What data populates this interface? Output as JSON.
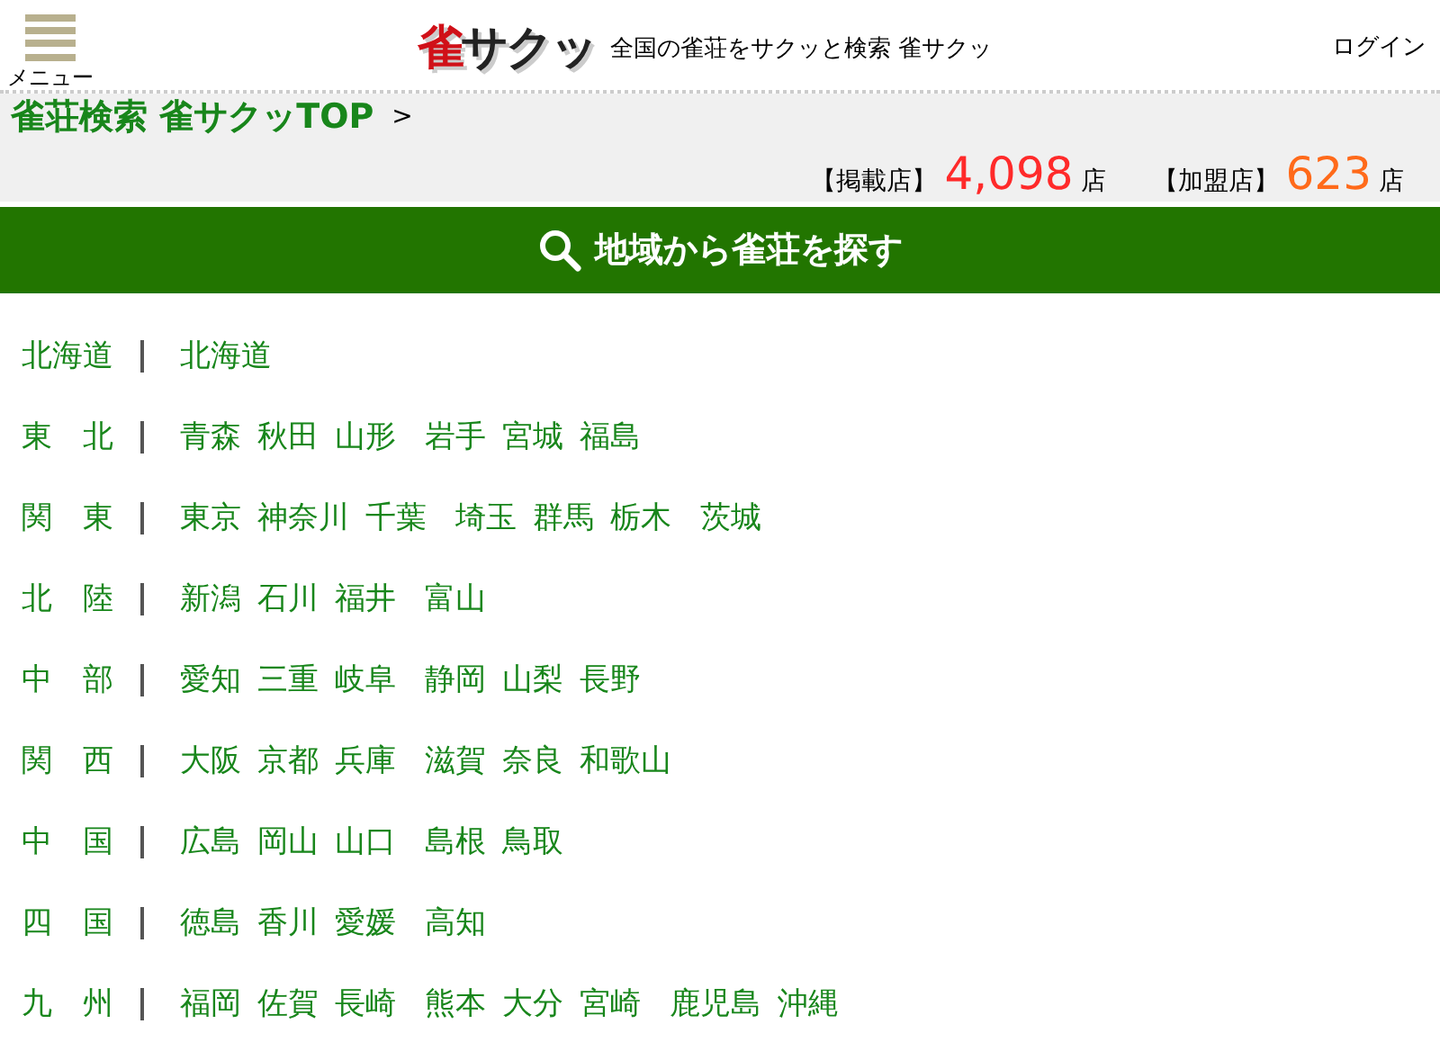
{
  "header": {
    "menu_label": "メニュー",
    "logo": {
      "mark": "雀",
      "text": "サクッ"
    },
    "tagline": "全国の雀荘をサクッと検索 雀サクッ",
    "login": "ログイン"
  },
  "breadcrumb": {
    "items": [
      "雀荘検索 雀サクッTOP"
    ],
    "separator": ">"
  },
  "counts": [
    {
      "label": "【掲載店】",
      "value": "4,098",
      "unit": "店",
      "color": "#ff2a2a"
    },
    {
      "label": "【加盟店】",
      "value": "623",
      "unit": "店",
      "color": "#ff6a1a"
    }
  ],
  "section_title": "地域から雀荘を探す",
  "regions": [
    {
      "name": "北海道",
      "prefectures": [
        "北海道"
      ]
    },
    {
      "name": "東　北",
      "prefectures": [
        "青森",
        "秋田",
        "山形",
        "岩手",
        "宮城",
        "福島"
      ]
    },
    {
      "name": "関　東",
      "prefectures": [
        "東京",
        "神奈川",
        "千葉",
        "埼玉",
        "群馬",
        "栃木",
        "茨城"
      ]
    },
    {
      "name": "北　陸",
      "prefectures": [
        "新潟",
        "石川",
        "福井",
        "富山"
      ]
    },
    {
      "name": "中　部",
      "prefectures": [
        "愛知",
        "三重",
        "岐阜",
        "静岡",
        "山梨",
        "長野"
      ]
    },
    {
      "name": "関　西",
      "prefectures": [
        "大阪",
        "京都",
        "兵庫",
        "滋賀",
        "奈良",
        "和歌山"
      ]
    },
    {
      "name": "中　国",
      "prefectures": [
        "広島",
        "岡山",
        "山口",
        "島根",
        "鳥取"
      ]
    },
    {
      "name": "四　国",
      "prefectures": [
        "徳島",
        "香川",
        "愛媛",
        "高知"
      ]
    },
    {
      "name": "九　州",
      "prefectures": [
        "福岡",
        "佐賀",
        "長崎",
        "熊本",
        "大分",
        "宮崎",
        "鹿児島",
        "沖縄"
      ]
    }
  ]
}
